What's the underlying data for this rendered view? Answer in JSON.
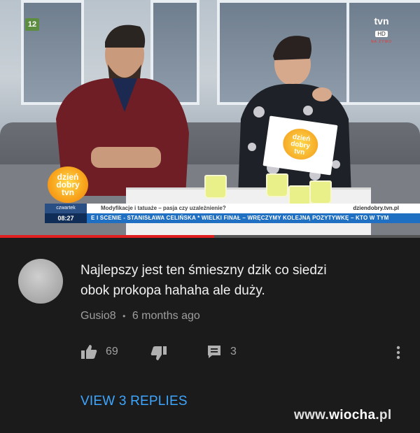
{
  "video": {
    "channel_number": "12",
    "broadcaster_logo": {
      "word": "tvn",
      "hd_label": "HD",
      "live_label": "NA ŻYWO"
    },
    "show_logo": {
      "line1": "dzień",
      "line2": "dobry",
      "line3": "tvn"
    },
    "card_logo": {
      "line1": "dzień",
      "line2": "dobry",
      "line3": "tvn"
    },
    "ticker": {
      "day": "czwartek",
      "time": "08:27",
      "headline": "Modyfikacje i tatuaże – pasja czy uzależnienie?",
      "url": "dziendobry.tvn.pl",
      "scroll_text": "E I SCENIE - STANISŁAWA CELIŃSKA * WIELKI FINAŁ – WRĘCZYMY KOLEJNĄ POZYTYWKĘ – KTO W TYM"
    },
    "progress_fraction": 0.51,
    "colors": {
      "progress": "#e02020",
      "ticker_blue": "#1f6fc3"
    }
  },
  "comment": {
    "text_line1": "Najlepszy jest ten śmieszny dzik co siedzi",
    "text_line2": "obok prokopa hahaha ale duży.",
    "author": "Gusio8",
    "separator": "•",
    "time_ago": "6 months ago",
    "likes": "69",
    "replies_count": "3",
    "view_replies_label": "VIEW 3 REPLIES",
    "icons": [
      "thumbs-up-icon",
      "thumbs-down-icon",
      "reply-icon",
      "more-vert-icon"
    ]
  },
  "watermark": {
    "prefix": "www.",
    "name": "wiocha",
    "suffix": ".pl"
  }
}
